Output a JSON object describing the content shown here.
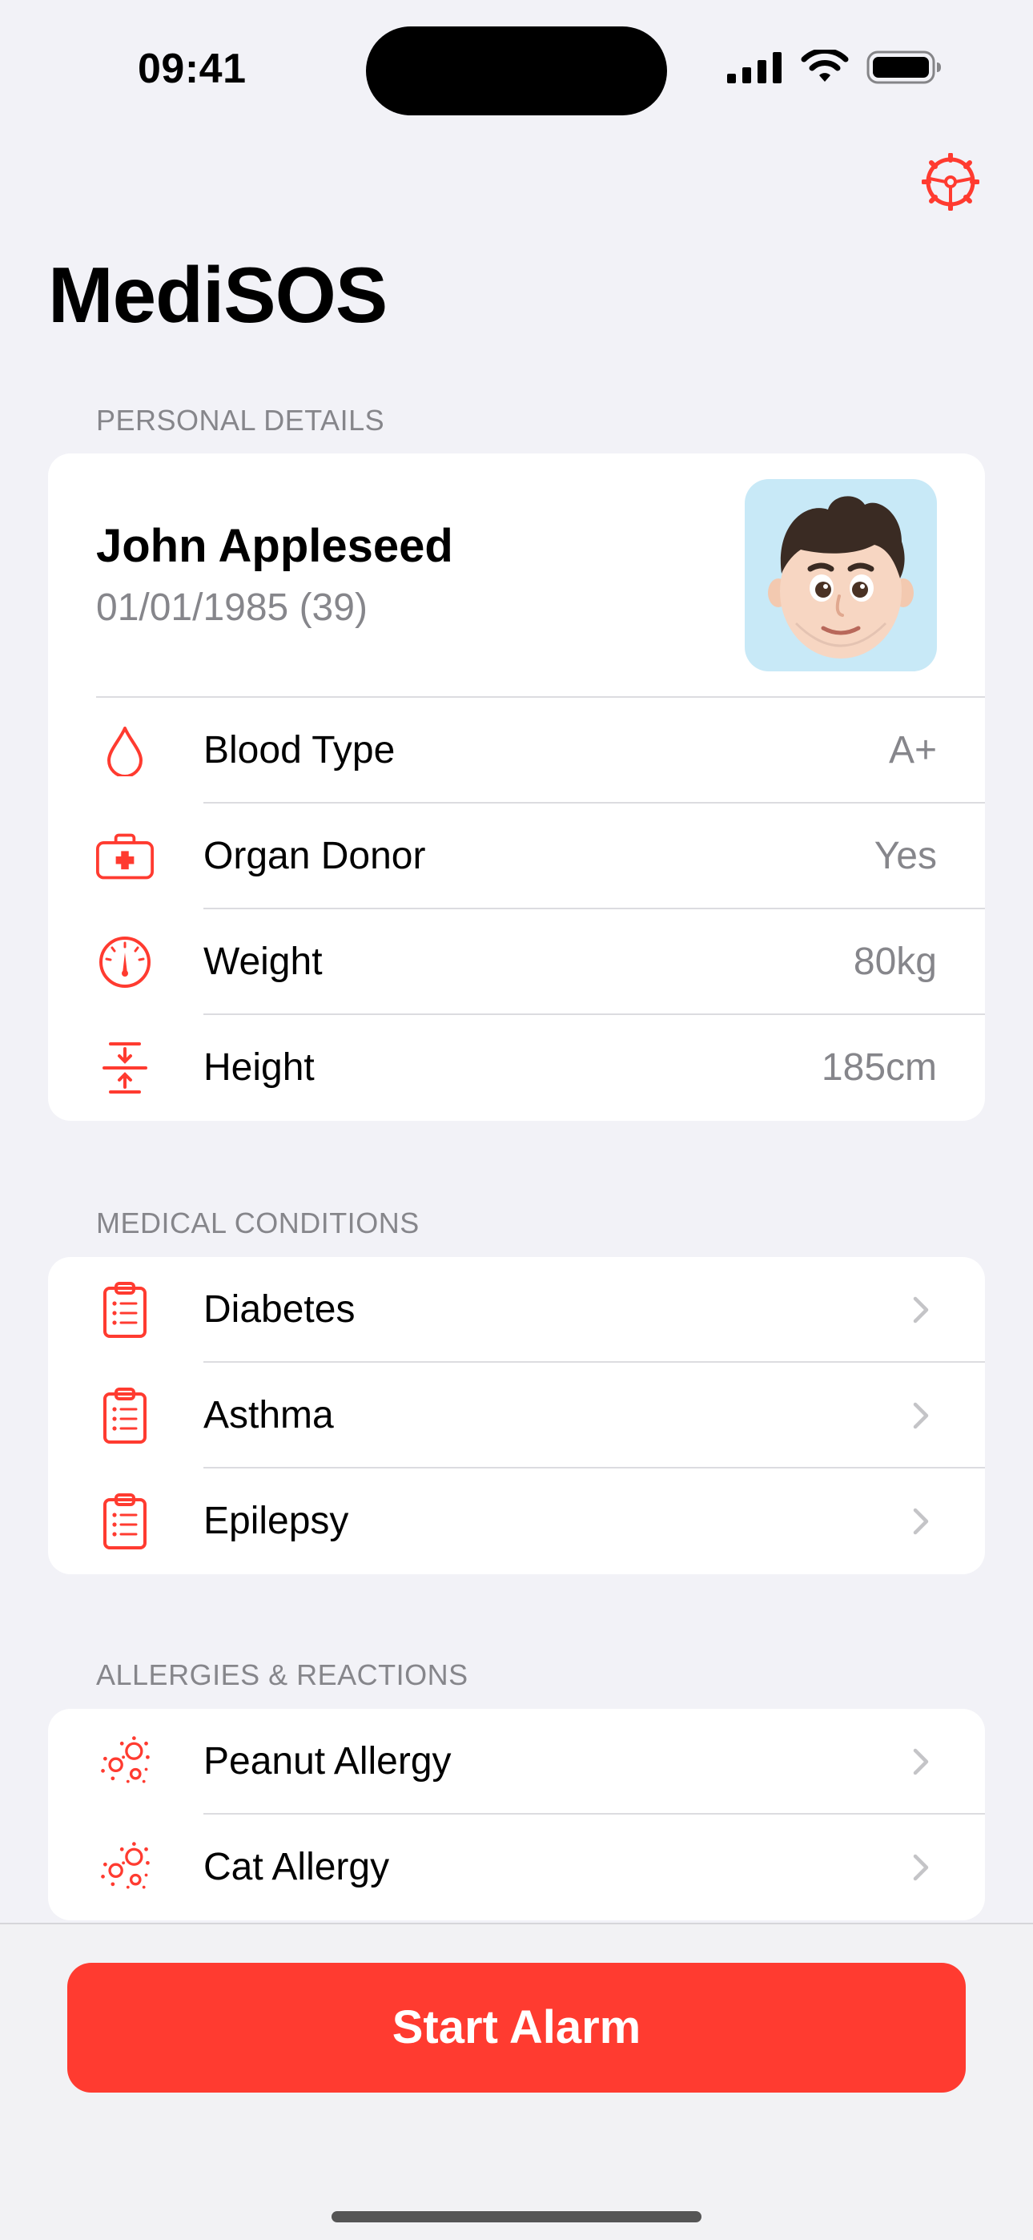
{
  "status_bar": {
    "time": "09:41"
  },
  "app": {
    "title": "MediSOS"
  },
  "colors": {
    "accent": "#ff3b30",
    "secondary_text": "#86868b",
    "background": "#f2f2f7"
  },
  "personal": {
    "header": "PERSONAL DETAILS",
    "name": "John Appleseed",
    "dob": "01/01/1985 (39)",
    "rows": [
      {
        "icon": "drop-icon",
        "label": "Blood Type",
        "value": "A+"
      },
      {
        "icon": "medical-kit-icon",
        "label": "Organ Donor",
        "value": "Yes"
      },
      {
        "icon": "gauge-icon",
        "label": "Weight",
        "value": "80kg"
      },
      {
        "icon": "height-icon",
        "label": "Height",
        "value": "185cm"
      }
    ]
  },
  "conditions": {
    "header": "MEDICAL CONDITIONS",
    "items": [
      {
        "icon": "clipboard-icon",
        "label": "Diabetes"
      },
      {
        "icon": "clipboard-icon",
        "label": "Asthma"
      },
      {
        "icon": "clipboard-icon",
        "label": "Epilepsy"
      }
    ]
  },
  "allergies": {
    "header": "ALLERGIES & REACTIONS",
    "items": [
      {
        "icon": "allergen-icon",
        "label": "Peanut Allergy"
      },
      {
        "icon": "allergen-icon",
        "label": "Cat Allergy"
      }
    ]
  },
  "action": {
    "label": "Start Alarm"
  }
}
